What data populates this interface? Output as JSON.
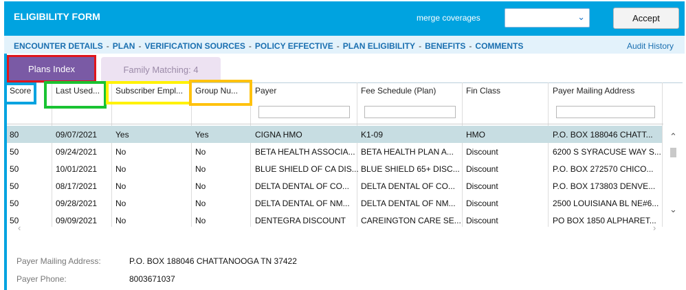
{
  "header": {
    "title": "ELIGIBILITY FORM",
    "merge_label": "merge coverages",
    "merge_value": "",
    "accept_label": "Accept"
  },
  "nav": {
    "links": [
      "ENCOUNTER DETAILS",
      "PLAN",
      "VERIFICATION SOURCES",
      "POLICY EFFECTIVE",
      "PLAN ELIGIBILITY",
      "BENEFITS",
      "COMMENTS"
    ],
    "separator": "-",
    "audit": "Audit History"
  },
  "tabs": {
    "plans_index": "Plans Index",
    "family_matching": "Family Matching: 4"
  },
  "table": {
    "columns": [
      "Score",
      "Last Used...",
      "Subscriber Empl...",
      "Group Nu...",
      "Payer",
      "Fee Schedule (Plan)",
      "Fin Class",
      "Payer Mailing Address"
    ],
    "rows": [
      [
        "80",
        "09/07/2021",
        "Yes",
        "Yes",
        "CIGNA HMO",
        "K1-09",
        "HMO",
        "P.O. BOX 188046 CHATT..."
      ],
      [
        "50",
        "09/24/2021",
        "No",
        "No",
        "BETA HEALTH ASSOCIA...",
        "BETA HEALTH PLAN A...",
        "Discount",
        "6200 S SYRACUSE WAY S..."
      ],
      [
        "50",
        "10/01/2021",
        "No",
        "No",
        "BLUE SHIELD OF CA DIS...",
        "BLUE SHIELD 65+ DISC...",
        "Discount",
        "P.O. BOX 272570 CHICO..."
      ],
      [
        "50",
        "08/17/2021",
        "No",
        "No",
        "DELTA DENTAL OF CO...",
        "DELTA DENTAL OF CO...",
        "Discount",
        "P.O. BOX 173803 DENVE..."
      ],
      [
        "50",
        "09/28/2021",
        "No",
        "No",
        "DELTA DENTAL OF NM...",
        "DELTA DENTAL OF NM...",
        "Discount",
        "2500 LOUISIANA BL NE#6..."
      ],
      [
        "50",
        "09/09/2021",
        "No",
        "No",
        "DENTEGRA DISCOUNT",
        "CAREINGTON CARE SE...",
        "Discount",
        "PO BOX 1850 ALPHARET..."
      ]
    ],
    "selected_row": 0
  },
  "details": {
    "mailing_label": "Payer Mailing Address:",
    "mailing_value": "P.O. BOX 188046 CHATTANOOGA TN 37422",
    "phone_label": "Payer Phone:",
    "phone_value": "8003671037"
  },
  "colors": {
    "header_bg": "#00a3e0",
    "nav_bg": "#e3f2fb",
    "tab_active_bg": "#7a5aa5",
    "selected_row_bg": "#c7dde2",
    "highlight_red": "#e0161c",
    "highlight_blue": "#00a3e0",
    "highlight_green": "#19c332",
    "highlight_yellow": "#fff200",
    "highlight_orange": "#ffc20e"
  },
  "icons": {
    "merge_chevron": "chevron-down-icon",
    "scroll_up": "chevron-up-icon",
    "scroll_down": "chevron-down-icon",
    "scroll_left": "chevron-left-icon",
    "scroll_right": "chevron-right-icon"
  }
}
